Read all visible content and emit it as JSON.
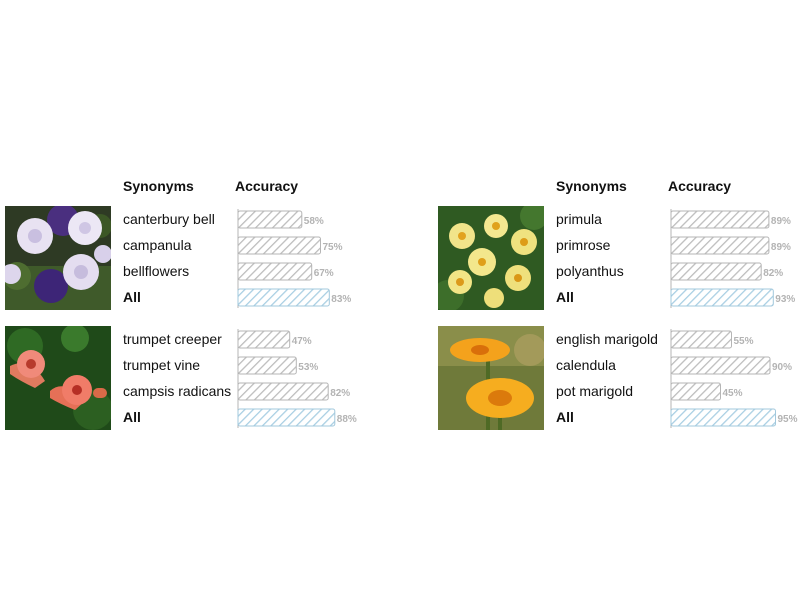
{
  "colors": {
    "bar_stripe_gray": "#bdbdbd",
    "bar_stripe_blue": "#a9cfe3",
    "bar_border_gray": "#b5b5b5",
    "bar_border_blue": "#a2c8dc",
    "percent_text": "#b3b3b3"
  },
  "left_panel": {
    "header_synonyms": "Synonyms",
    "header_accuracy": "Accuracy"
  },
  "right_panel": {
    "header_synonyms": "Synonyms",
    "header_accuracy": "Accuracy"
  },
  "chart_data": [
    {
      "type": "bar",
      "orientation": "horizontal",
      "categories": [
        "canterbury bell",
        "campanula",
        "bellflowers",
        "All"
      ],
      "values": [
        58,
        75,
        67,
        83
      ],
      "value_labels": [
        "58%",
        "75%",
        "67%",
        "83%"
      ],
      "xlim": [
        0,
        100
      ],
      "image": "canterbury-bell-photo"
    },
    {
      "type": "bar",
      "orientation": "horizontal",
      "categories": [
        "trumpet creeper",
        "trumpet vine",
        "campsis radicans",
        "All"
      ],
      "values": [
        47,
        53,
        82,
        88
      ],
      "value_labels": [
        "47%",
        "53%",
        "82%",
        "88%"
      ],
      "xlim": [
        0,
        100
      ],
      "image": "trumpet-creeper-photo"
    },
    {
      "type": "bar",
      "orientation": "horizontal",
      "categories": [
        "primula",
        "primrose",
        "polyanthus",
        "All"
      ],
      "values": [
        89,
        89,
        82,
        93
      ],
      "value_labels": [
        "89%",
        "89%",
        "82%",
        "93%"
      ],
      "xlim": [
        0,
        100
      ],
      "image": "primrose-photo"
    },
    {
      "type": "bar",
      "orientation": "horizontal",
      "categories": [
        "english marigold",
        "calendula",
        "pot marigold",
        "All"
      ],
      "values": [
        55,
        90,
        45,
        95
      ],
      "value_labels": [
        "55%",
        "90%",
        "45%",
        "95%"
      ],
      "xlim": [
        0,
        100
      ],
      "image": "marigold-photo"
    }
  ]
}
